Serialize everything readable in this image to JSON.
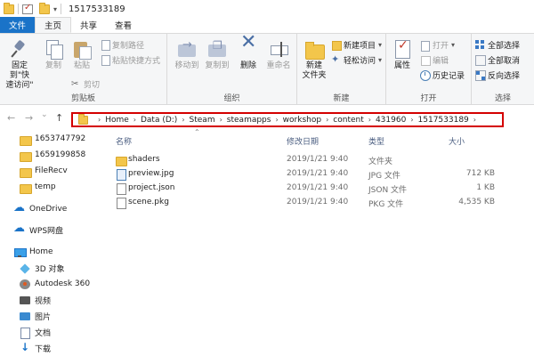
{
  "window": {
    "title": "1517533189",
    "quick_access_arrow": "▾"
  },
  "tabs": [
    {
      "label": "文件"
    },
    {
      "label": "主页"
    },
    {
      "label": "共享"
    },
    {
      "label": "查看"
    }
  ],
  "ribbon": {
    "clipboard": {
      "pin_label": "固定到\"快\n速访问\"",
      "copy_label": "复制",
      "paste_label": "粘贴",
      "copy_path_label": "复制路径",
      "paste_shortcut_label": "粘贴快捷方式",
      "cut_label": "剪切",
      "group_label": "剪贴板"
    },
    "organize": {
      "move_to_label": "移动到",
      "copy_to_label": "复制到",
      "delete_label": "删除",
      "rename_label": "重命名",
      "group_label": "组织"
    },
    "new": {
      "new_folder_label": "新建\n文件夹",
      "new_item_label": "新建项目",
      "easy_access_label": "轻松访问",
      "group_label": "新建"
    },
    "open": {
      "properties_label": "属性",
      "open_label": "打开",
      "edit_label": "编辑",
      "history_label": "历史记录",
      "group_label": "打开"
    },
    "select": {
      "select_all_label": "全部选择",
      "select_none_label": "全部取消",
      "invert_label": "反向选择",
      "group_label": "选择"
    }
  },
  "nav": {
    "back": "←",
    "forward": "→",
    "dropdown": "⌄",
    "up": "↑"
  },
  "breadcrumb": [
    "Home",
    "Data (D:)",
    "Steam",
    "steamapps",
    "workshop",
    "content",
    "431960",
    "1517533189"
  ],
  "breadcrumb_sep": "›",
  "sidebar": {
    "items": [
      {
        "label": "1653747792"
      },
      {
        "label": "1659199858"
      },
      {
        "label": "FileRecv"
      },
      {
        "label": "temp"
      },
      {
        "label": "OneDrive"
      },
      {
        "label": "WPS网盘"
      },
      {
        "label": "Home"
      },
      {
        "label": "3D 对象"
      },
      {
        "label": "Autodesk 360"
      },
      {
        "label": "视频"
      },
      {
        "label": "图片"
      },
      {
        "label": "文档"
      },
      {
        "label": "下载"
      }
    ]
  },
  "file_list": {
    "sort_caret": "⌃",
    "columns": {
      "name": "名称",
      "date": "修改日期",
      "type": "类型",
      "size": "大小"
    },
    "rows": [
      {
        "name": "shaders",
        "date": "2019/1/21 9:40",
        "type": "文件夹",
        "size": "",
        "icon": "folder"
      },
      {
        "name": "preview.jpg",
        "date": "2019/1/21 9:40",
        "type": "JPG 文件",
        "size": "712 KB",
        "icon": "image"
      },
      {
        "name": "project.json",
        "date": "2019/1/21 9:40",
        "type": "JSON 文件",
        "size": "1 KB",
        "icon": "doc"
      },
      {
        "name": "scene.pkg",
        "date": "2019/1/21 9:40",
        "type": "PKG 文件",
        "size": "4,535 KB",
        "icon": "doc"
      }
    ]
  }
}
